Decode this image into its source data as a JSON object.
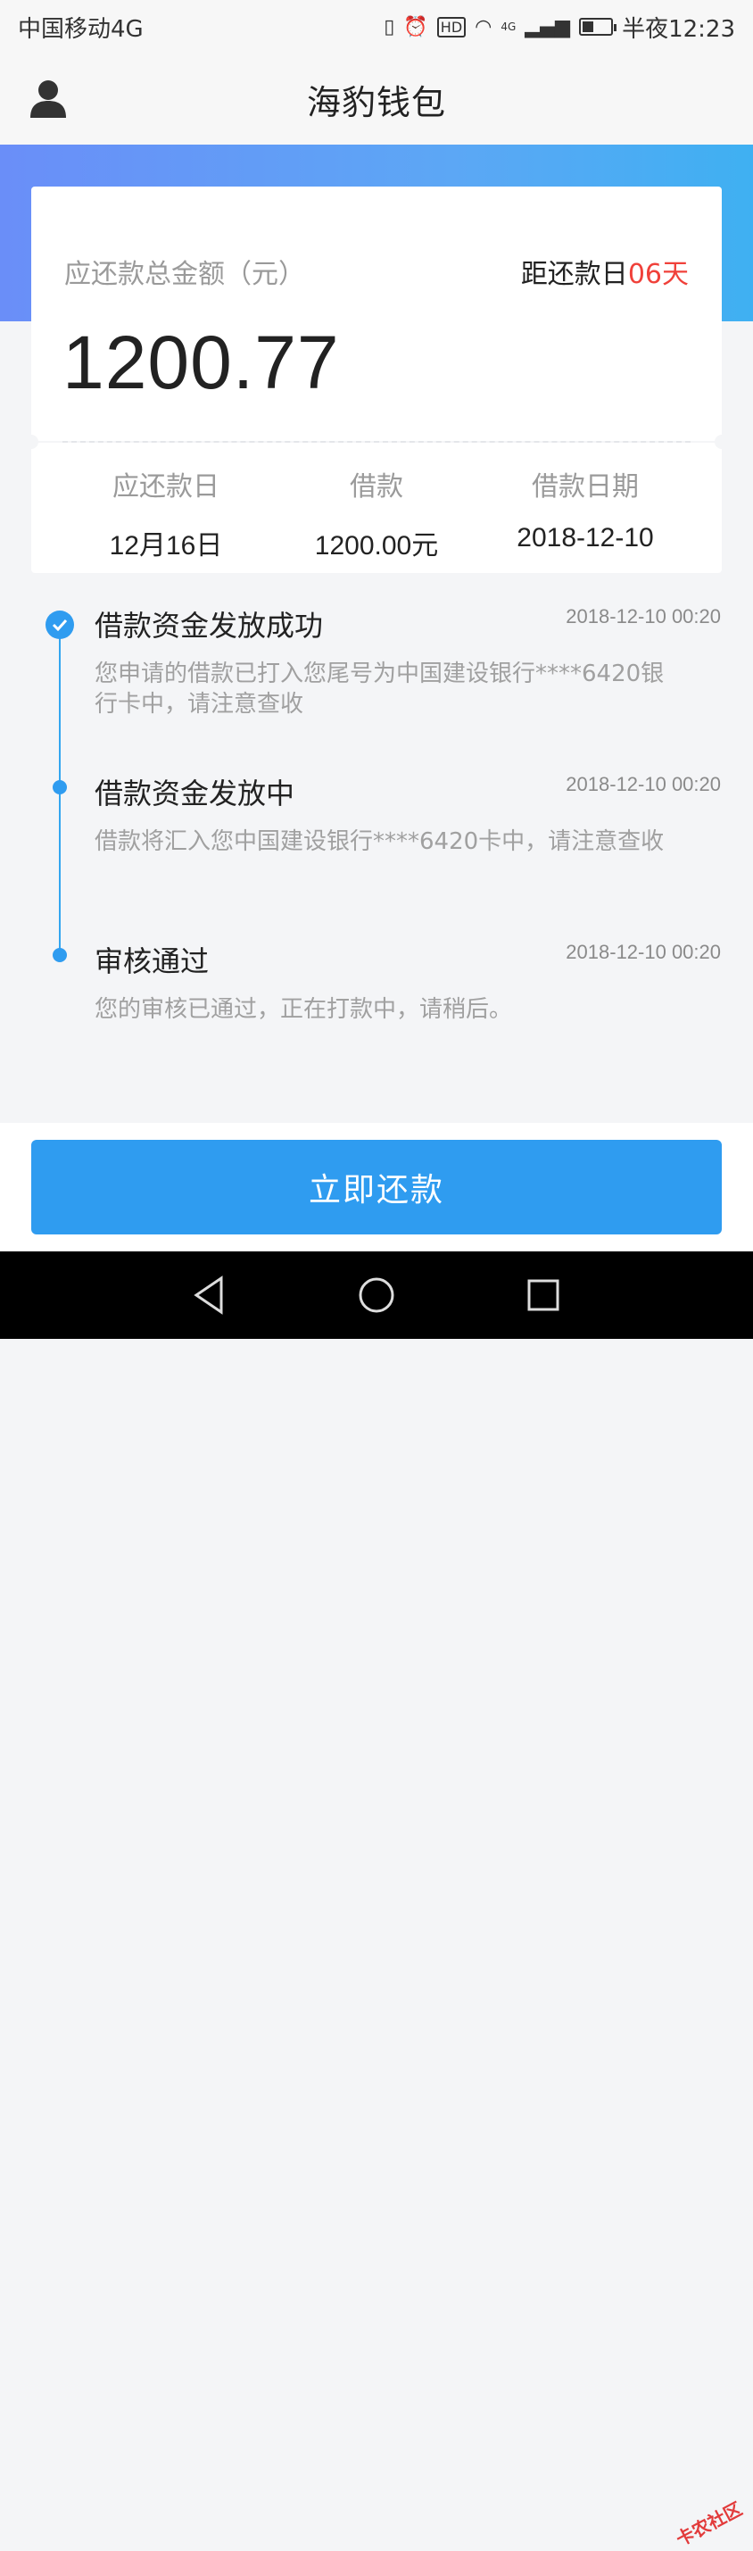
{
  "status_bar": {
    "carrier": "中国移动4G",
    "time": "半夜12:23",
    "hd_label": "HD",
    "network_label": "4G"
  },
  "header": {
    "title": "海豹钱包"
  },
  "summary": {
    "due_label": "应还款总金额（元）",
    "countdown_prefix": "距还款日",
    "countdown_days": "06天",
    "amount": "1200.77",
    "details": [
      {
        "label": "应还款日",
        "value": "12月16日"
      },
      {
        "label": "借款",
        "value": "1200.00元"
      },
      {
        "label": "借款日期",
        "value": "2018-12-10"
      }
    ]
  },
  "timeline": [
    {
      "title": "借款资金发放成功",
      "time": "2018-12-10 00:20",
      "desc": "您申请的借款已打入您尾号为中国建设银行****6420银行卡中，请注意查收"
    },
    {
      "title": "借款资金发放中",
      "time": "2018-12-10 00:20",
      "desc": "借款将汇入您中国建设银行****6420卡中，请注意查收"
    },
    {
      "title": "审核通过",
      "time": "2018-12-10 00:20",
      "desc": "您的审核已通过，正在打款中，请稍后。"
    }
  ],
  "actions": {
    "repay_label": "立即还款"
  },
  "watermark": "卡农社区",
  "colors": {
    "accent": "#2f9cf0",
    "countdown": "#f0413a",
    "hero_start": "#6a8ef8",
    "hero_end": "#3fb0f2"
  }
}
